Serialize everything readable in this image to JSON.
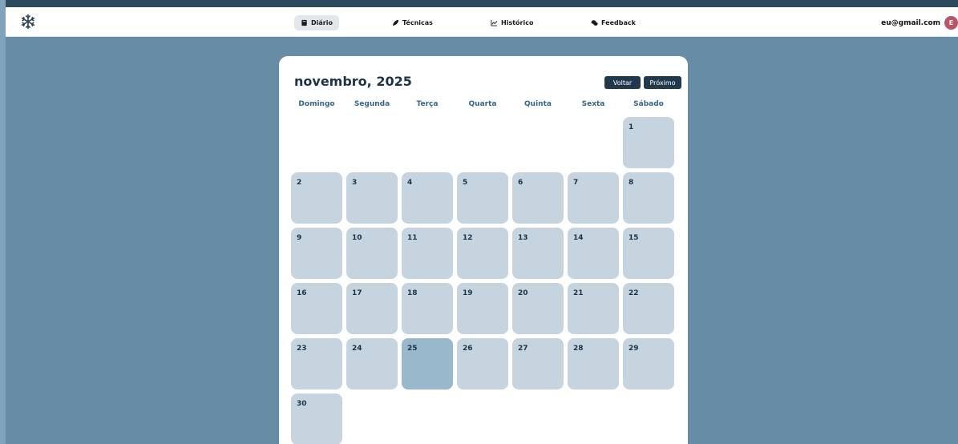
{
  "nav": {
    "items": [
      {
        "label": "Diário",
        "icon": "book-icon",
        "active": true
      },
      {
        "label": "Técnicas",
        "icon": "leaf-icon",
        "active": false
      },
      {
        "label": "Histórico",
        "icon": "chart-line-icon",
        "active": false
      },
      {
        "label": "Feedback",
        "icon": "chat-bubbles-icon",
        "active": false
      }
    ]
  },
  "user": {
    "email": "eu@gmail.com",
    "avatar_initial": "E"
  },
  "calendar": {
    "title": "novembro, 2025",
    "prev_label": "Voltar",
    "next_label": "Próximo",
    "weekdays": [
      "Domingo",
      "Segunda",
      "Terça",
      "Quarta",
      "Quinta",
      "Sexta",
      "Sábado"
    ],
    "first_weekday_index": 6,
    "days_in_month": 30,
    "highlighted_day": 25,
    "days": [
      "1",
      "2",
      "3",
      "4",
      "5",
      "6",
      "7",
      "8",
      "9",
      "10",
      "11",
      "12",
      "13",
      "14",
      "15",
      "16",
      "17",
      "18",
      "19",
      "20",
      "21",
      "22",
      "23",
      "24",
      "25",
      "26",
      "27",
      "28",
      "29",
      "30"
    ]
  },
  "colors": {
    "background": "#668ca6",
    "card": "#ffffff",
    "day_cell": "#c6d4df",
    "day_highlight": "#9ab8cb",
    "button": "#21394d",
    "weekday_text": "#33678e"
  }
}
